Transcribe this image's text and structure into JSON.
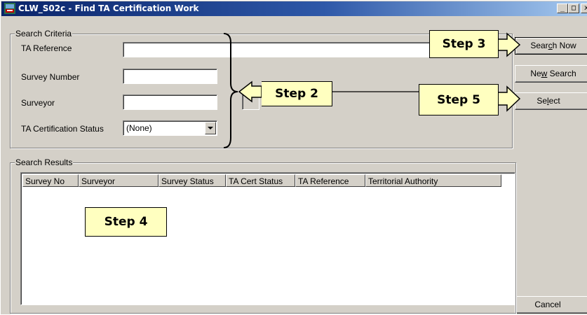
{
  "window": {
    "title": "CLW_S02c - Find TA Certification Work",
    "controls": {
      "minimize": "_",
      "maximize": "□",
      "close": "x"
    }
  },
  "search_criteria": {
    "group_label": "Search Criteria",
    "ta_reference_label": "TA Reference",
    "ta_reference_value": "",
    "survey_number_label": "Survey Number",
    "survey_number_value": "",
    "surveyor_label": "Surveyor",
    "surveyor_value": "",
    "ta_cert_status_label": "TA Certification Status",
    "ta_cert_status_value": "(None)"
  },
  "buttons": {
    "search_now": {
      "pre": "Sear",
      "mnemonic": "c",
      "post": "h Now"
    },
    "new_search": {
      "pre": "Ne",
      "mnemonic": "w",
      "post": " Search"
    },
    "select": {
      "pre": "Se",
      "mnemonic": "l",
      "post": "ect"
    },
    "cancel": "Cancel"
  },
  "search_results": {
    "group_label": "Search Results",
    "columns": [
      "Survey No",
      "Surveyor",
      "Survey Status",
      "TA Cert Status",
      "TA Reference",
      "Territorial Authority"
    ],
    "rows": []
  },
  "callouts": {
    "step2": "Step 2",
    "step3": "Step 3",
    "step4": "Step 4",
    "step5": "Step 5"
  },
  "colors": {
    "titlebar_start": "#0a246a",
    "titlebar_end": "#a6caf0",
    "window_face": "#d4d0c8",
    "callout_fill": "#ffffc0"
  }
}
